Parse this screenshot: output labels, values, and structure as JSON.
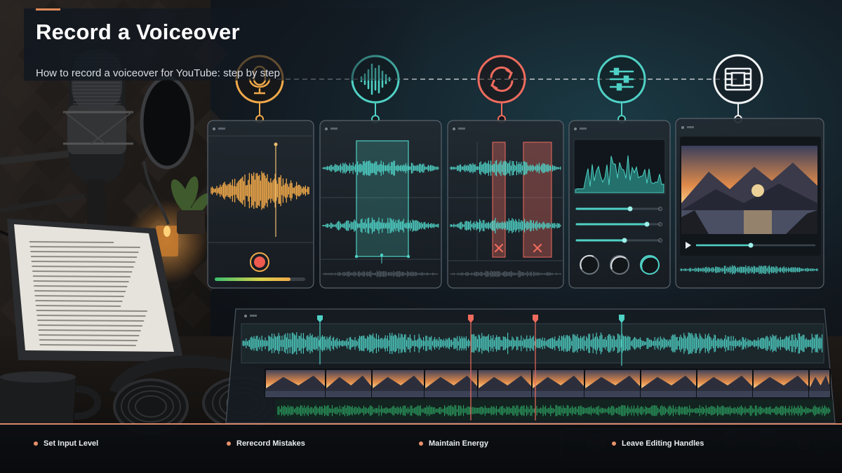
{
  "header": {
    "title": "Record a Voiceover",
    "subtitle": "How to record a voiceover for YouTube: step by step"
  },
  "steps": [
    {
      "icon": "microphone-icon",
      "color": "#f0a94a"
    },
    {
      "icon": "waveform-icon",
      "color": "#4fd1c5"
    },
    {
      "icon": "rerecord-icon",
      "color": "#ef6b5e"
    },
    {
      "icon": "sliders-icon",
      "color": "#4fd1c5"
    },
    {
      "icon": "film-icon",
      "color": "#f2f4f6"
    }
  ],
  "footer": {
    "tips": [
      {
        "label": "Set Input Level"
      },
      {
        "label": "Rerecord Mistakes"
      },
      {
        "label": "Maintain Energy"
      },
      {
        "label": "Leave Editing Handles"
      }
    ]
  },
  "colors": {
    "accent": "#e8916b",
    "teal": "#4fd1c5",
    "amber": "#f0a94a",
    "red": "#ef6b5e"
  }
}
